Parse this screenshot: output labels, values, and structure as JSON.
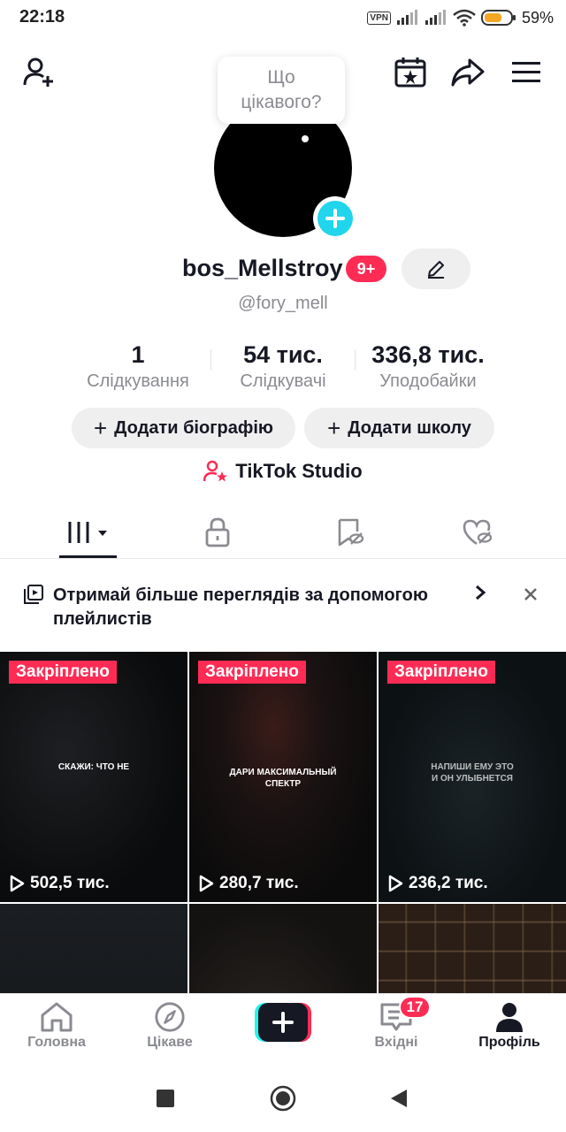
{
  "status_bar": {
    "time": "22:18",
    "vpn": "VPN",
    "battery": "59%"
  },
  "profile": {
    "bubble_text": "Що\nцікавого?",
    "username": "bos_Mellstroy",
    "notif_badge": "9+",
    "handle": "@fory_mell",
    "stats": [
      {
        "value": "1",
        "label": "Слідкування"
      },
      {
        "value": "54 тис.",
        "label": "Слідкувачі"
      },
      {
        "value": "336,8 тис.",
        "label": "Уподобайки"
      }
    ],
    "actions": {
      "add_bio": "Додати біографію",
      "add_school": "Додати школу"
    },
    "studio": "TikTok Studio"
  },
  "playlist_banner": {
    "text": "Отримай більше переглядів за допомогою плейлистів"
  },
  "videos": [
    {
      "pinned": "Закріплено",
      "overlay": "СКАЖИ: ЧТО НЕ",
      "views": "502,5 тис."
    },
    {
      "pinned": "Закріплено",
      "overlay": "ДАРИ МАКСИМАЛЬНЫЙ\nСПЕКТР",
      "views": "280,7 тис."
    },
    {
      "pinned": "Закріплено",
      "overlay": "НАПИШИ ЕМУ ЭТО\nИ ОН УЛЫБНЕТСЯ",
      "views": "236,2 тис."
    }
  ],
  "bottom_nav": {
    "home": "Головна",
    "discover": "Цікаве",
    "inbox": "Вхідні",
    "inbox_badge": "17",
    "profile": "Профіль"
  },
  "colors": {
    "accent": "#fe2c55",
    "cyan": "#20d5ec",
    "text": "#161823",
    "muted": "#8a8b91"
  }
}
